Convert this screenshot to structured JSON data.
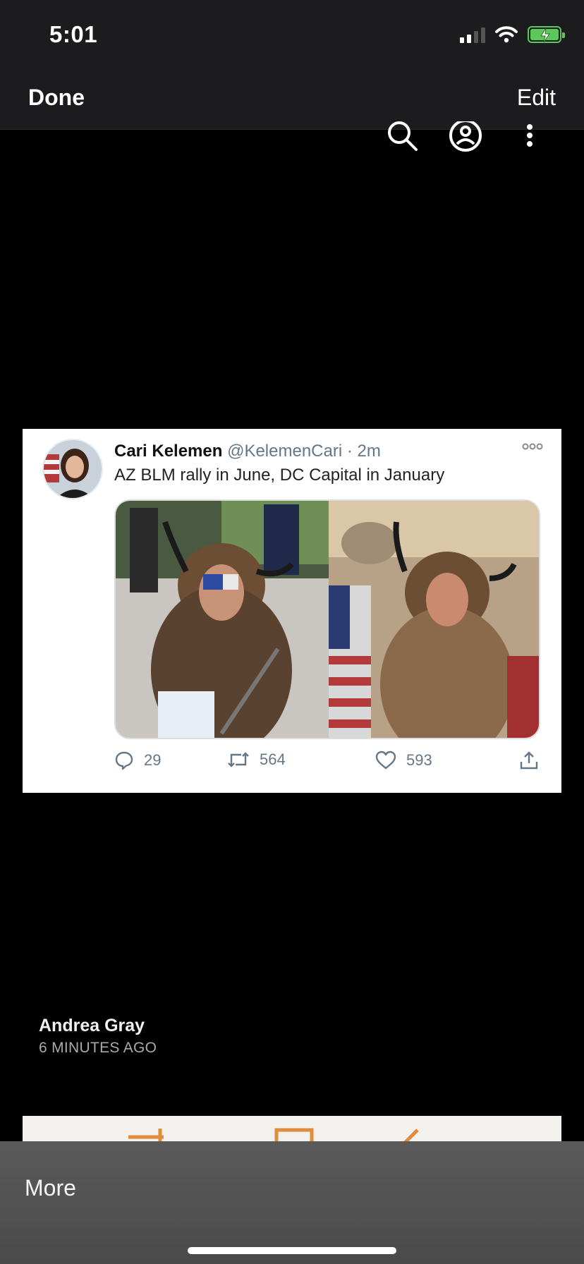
{
  "status_bar": {
    "time": "5:01"
  },
  "nav": {
    "done_label": "Done",
    "edit_label": "Edit"
  },
  "tweet": {
    "name": "Cari Kelemen",
    "handle": "@KelemenCari",
    "age": "· 2m",
    "text": "AZ BLM rally in June, DC Capital in January",
    "replies": "29",
    "retweets": "564",
    "likes": "593"
  },
  "post": {
    "author": "Andrea Gray",
    "timestamp": "6 MINUTES AGO"
  },
  "bottom_bar": {
    "more_label": "More"
  },
  "colors": {
    "background": "#000000",
    "nav_bar": "#1c1c1e",
    "battery": "#5ac85a",
    "tweet_meta": "#657786",
    "bottom_bar": "#4f4f4f"
  },
  "icons": [
    "search-icon",
    "profile-icon",
    "more-vertical-icon",
    "more-horizontal-icon",
    "reply-icon",
    "retweet-icon",
    "like-icon",
    "share-icon",
    "wifi-icon",
    "battery-icon"
  ]
}
